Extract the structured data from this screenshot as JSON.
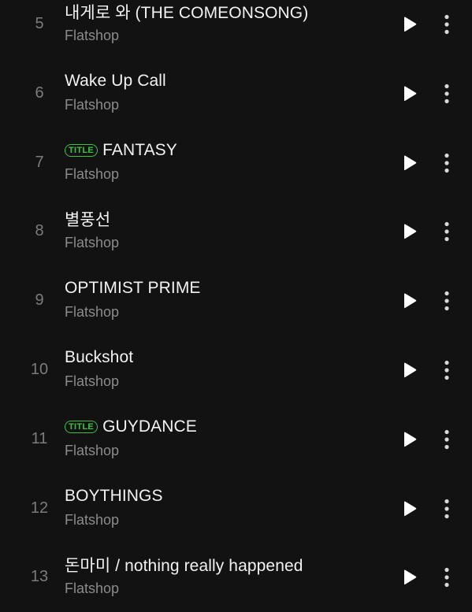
{
  "tracks": [
    {
      "number": "5",
      "title": "내게로 와 (THE COMEONSONG)",
      "artist": "Flatshop",
      "badge": ""
    },
    {
      "number": "6",
      "title": "Wake Up Call",
      "artist": "Flatshop",
      "badge": ""
    },
    {
      "number": "7",
      "title": "FANTASY",
      "artist": "Flatshop",
      "badge": "TITLE"
    },
    {
      "number": "8",
      "title": "별풍선",
      "artist": "Flatshop",
      "badge": ""
    },
    {
      "number": "9",
      "title": "OPTIMIST PRIME",
      "artist": "Flatshop",
      "badge": ""
    },
    {
      "number": "10",
      "title": "Buckshot",
      "artist": "Flatshop",
      "badge": ""
    },
    {
      "number": "11",
      "title": "GUYDANCE",
      "artist": "Flatshop",
      "badge": "TITLE"
    },
    {
      "number": "12",
      "title": "BOYTHINGS",
      "artist": "Flatshop",
      "badge": ""
    },
    {
      "number": "13",
      "title": "돈마미 / nothing really happened",
      "artist": "Flatshop",
      "badge": ""
    }
  ],
  "icons": {
    "play": "play-icon",
    "more": "more-vertical-icon"
  },
  "colors": {
    "background": "#121212",
    "title_text": "#f2f2f2",
    "artist_text": "#8b8b8b",
    "number_text": "#7c7c7c",
    "badge_accent": "#3fc142"
  }
}
